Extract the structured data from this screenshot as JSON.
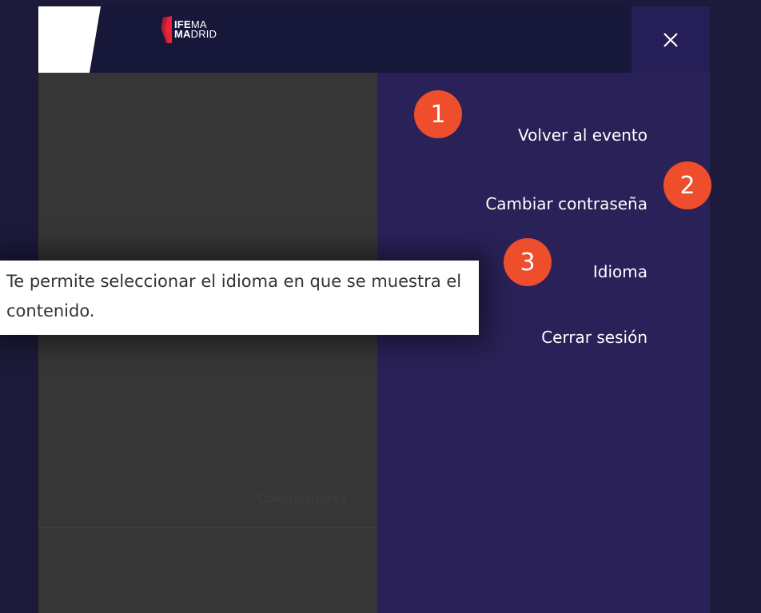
{
  "header": {
    "logo": {
      "line1_bold": "IFE",
      "line1_rest": "MA",
      "line2_bold": "MA",
      "line2_rest": "DRID",
      "icon": "ifema-madrid-logo"
    },
    "close_icon": "close-icon"
  },
  "content": {
    "label": "Coexpositores"
  },
  "menu": {
    "items": [
      {
        "label": "Volver al evento"
      },
      {
        "label": "Cambiar contraseña"
      },
      {
        "label": "Idioma"
      },
      {
        "label": "Cerrar sesión"
      }
    ]
  },
  "tooltip": {
    "text": "Te permite seleccionar el idioma en que se muestra el contenido."
  },
  "badges": [
    "1",
    "2",
    "3"
  ],
  "colors": {
    "header_bg": "#17173a",
    "menu_bg": "#2a2158",
    "badge": "#ee4e2b",
    "content_bg": "#363636"
  }
}
